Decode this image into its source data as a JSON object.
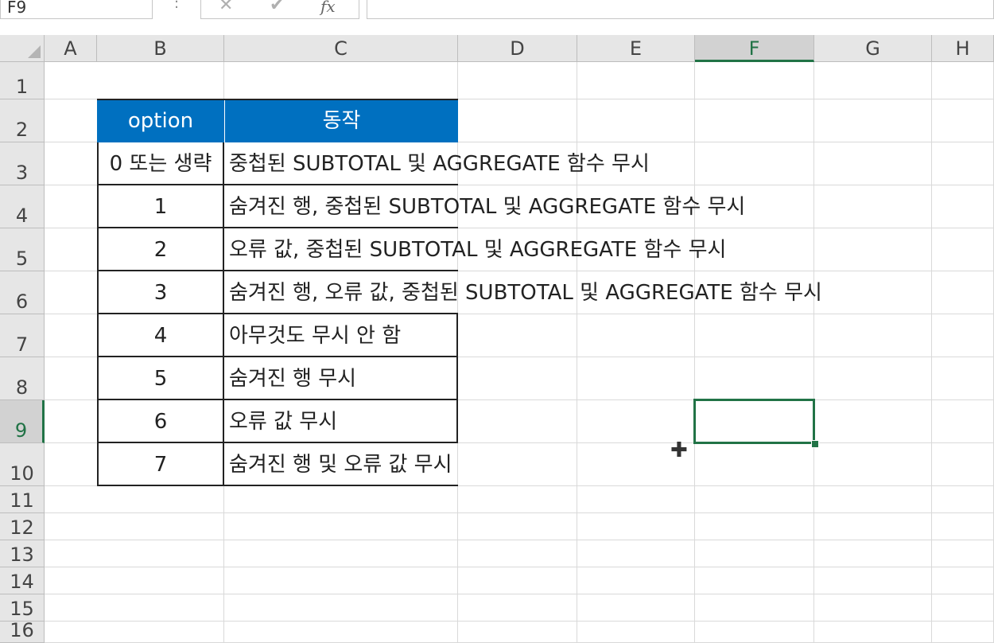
{
  "formula_bar": {
    "name_box": "F9",
    "separator": ":",
    "cancel_glyph": "✕",
    "enter_glyph": "✔",
    "fx_label": "fx",
    "formula": ""
  },
  "columns": [
    "A",
    "B",
    "C",
    "D",
    "E",
    "F",
    "G",
    "H"
  ],
  "rows": [
    "1",
    "2",
    "3",
    "4",
    "5",
    "6",
    "7",
    "8",
    "9",
    "10",
    "11",
    "12",
    "13",
    "14",
    "15",
    "16"
  ],
  "selected_column": "F",
  "selected_row": "9",
  "table": {
    "header": {
      "option": "option",
      "action": "동작"
    },
    "rows": [
      {
        "option": "0 또는 생략",
        "action": "중첩된 SUBTOTAL 및 AGGREGATE 함수 무시"
      },
      {
        "option": "1",
        "action": "숨겨진 행, 중첩된 SUBTOTAL 및 AGGREGATE 함수 무시"
      },
      {
        "option": "2",
        "action": "오류 값, 중첩된 SUBTOTAL 및 AGGREGATE 함수 무시"
      },
      {
        "option": "3",
        "action": "숨겨진 행, 오류 값, 중첩된 SUBTOTAL 및 AGGREGATE 함수 무시"
      },
      {
        "option": "4",
        "action": "아무것도 무시 안 함"
      },
      {
        "option": "5",
        "action": "숨겨진 행 무시"
      },
      {
        "option": "6",
        "action": "오류 값 무시"
      },
      {
        "option": "7",
        "action": "숨겨진 행 및 오류 값 무시"
      }
    ]
  },
  "colors": {
    "header_fill": "#0070c0",
    "selection": "#217346"
  },
  "icons": {
    "cursor": "cell-select-cursor-icon"
  }
}
